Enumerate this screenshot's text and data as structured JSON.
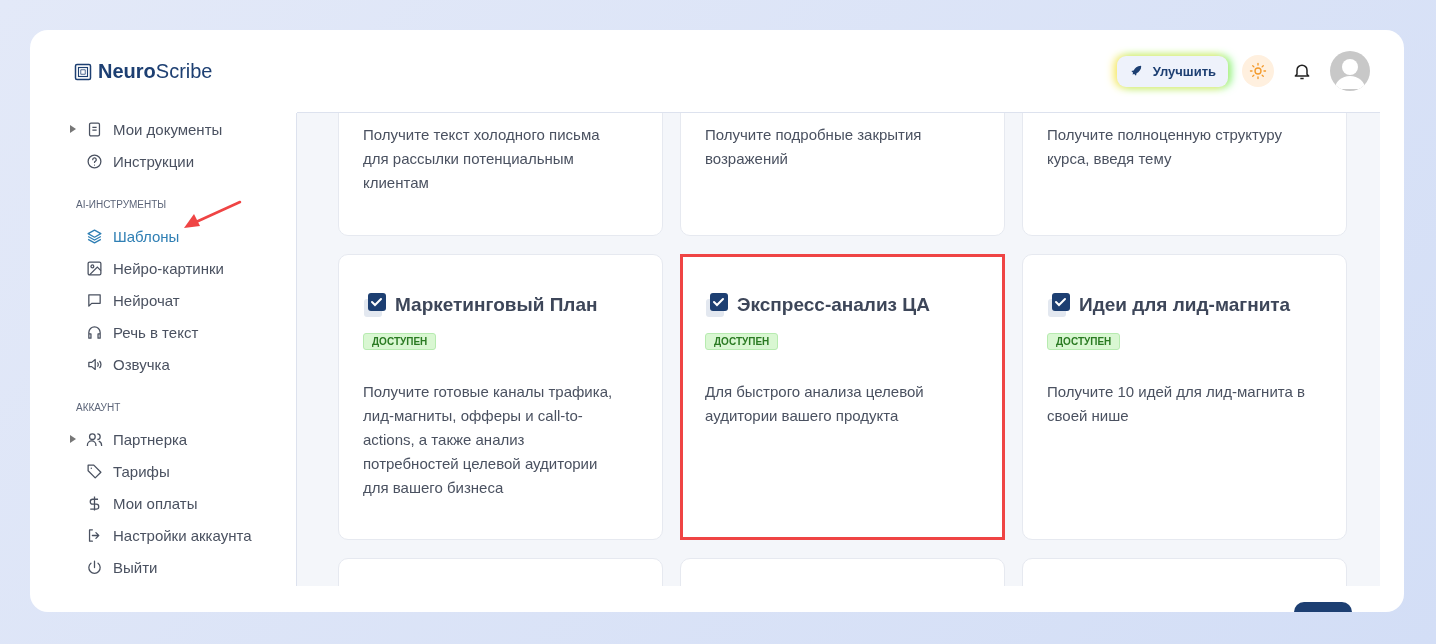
{
  "logo": {
    "bold": "Neuro",
    "light": "Scribe"
  },
  "header": {
    "upgrade_label": "Улучшить"
  },
  "sidebar": {
    "sections": [
      {
        "items": [
          {
            "label": "Мои документы",
            "expandable": true,
            "selected": false,
            "arrow": false
          },
          {
            "label": "Инструкции",
            "expandable": false,
            "selected": false,
            "arrow": false
          }
        ]
      },
      {
        "heading": "AI-ИНСТРУМЕНТЫ",
        "items": [
          {
            "label": "Шаблоны",
            "expandable": false,
            "selected": true,
            "arrow": true
          },
          {
            "label": "Нейро-картинки",
            "expandable": false,
            "selected": false,
            "arrow": false
          },
          {
            "label": "Нейрочат",
            "expandable": false,
            "selected": false,
            "arrow": false
          },
          {
            "label": "Речь в текст",
            "expandable": false,
            "selected": false,
            "arrow": false
          },
          {
            "label": "Озвучка",
            "expandable": false,
            "selected": false,
            "arrow": false
          }
        ]
      },
      {
        "heading": "АККАУНТ",
        "items": [
          {
            "label": "Партнерка",
            "expandable": true,
            "selected": false,
            "arrow": false
          },
          {
            "label": "Тарифы",
            "expandable": false,
            "selected": false,
            "arrow": false
          },
          {
            "label": "Мои оплаты",
            "expandable": false,
            "selected": false,
            "arrow": false
          },
          {
            "label": "Настройки аккаунта",
            "expandable": false,
            "selected": false,
            "arrow": false
          },
          {
            "label": "Выйти",
            "expandable": false,
            "selected": false,
            "arrow": false
          }
        ]
      }
    ]
  },
  "cards": [
    {
      "description": "Получите текст холодного письма для рассылки потенциальным клиентам",
      "highlighted": false
    },
    {
      "description": "Получите подробные закрытия возражений",
      "highlighted": false
    },
    {
      "description": "Получите полноценную структуру курса, введя тему",
      "highlighted": false
    },
    {
      "title": "Маркетинговый План",
      "badge": "ДОСТУПЕН",
      "description": "Получите готовые каналы трафика, лид-магниты, офферы и call-to-actions, а также анализ потребностей целевой аудитории для вашего бизнеса",
      "highlighted": false
    },
    {
      "title": "Экспресс-анализ ЦА",
      "badge": "ДОСТУПЕН",
      "description": "Для быстрого анализа целевой аудитории вашего продукта",
      "highlighted": true
    },
    {
      "title": "Идеи для лид-магнита",
      "badge": "ДОСТУПЕН",
      "description": "Получите 10 идей для лид-магнита в своей нише",
      "highlighted": false
    },
    {
      "highlighted": false
    },
    {
      "highlighted": false
    },
    {
      "highlighted": false
    }
  ]
}
